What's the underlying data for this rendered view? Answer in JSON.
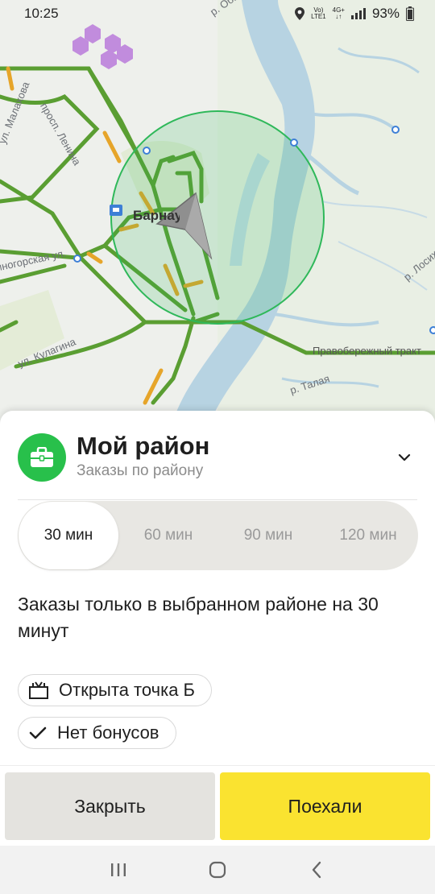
{
  "status_bar": {
    "time": "10:25",
    "network_top": "Vo)",
    "network_bottom": "LTE1",
    "network_gen": "4G+",
    "battery": "93%",
    "icons": [
      "location-icon",
      "signal-icon",
      "battery-icon"
    ]
  },
  "map": {
    "labels": {
      "lenina": "просп. Ленина",
      "malakhova": "ул. Малахова",
      "zmeinogorsk": "Змеиногорская ул.",
      "kulagina": "ул. Кулагина",
      "city": "Барнаул",
      "pravoberezhny": "Правобережный тракт",
      "talaya": "р. Талая",
      "losikha": "р. Лосиха",
      "ob": "р. Обь"
    },
    "colors": {
      "road_green": "#5a9e32",
      "road_orange": "#e6a52a",
      "river": "#b7d3e2",
      "radius": "#2fb85a"
    }
  },
  "sheet": {
    "title": "Мой район",
    "subtitle": "Заказы по району",
    "icon": "briefcase-icon",
    "segments": [
      {
        "label": "30 мин",
        "active": true
      },
      {
        "label": "60 мин",
        "active": false
      },
      {
        "label": "90 мин",
        "active": false
      },
      {
        "label": "120 мин",
        "active": false
      }
    ],
    "description": "Заказы только в выбранном районе на 30 минут",
    "chips": [
      {
        "label": "Открыта точка Б",
        "icon": "gift-icon"
      },
      {
        "label": "Нет бонусов",
        "icon": "check-icon"
      }
    ],
    "buttons": {
      "close": "Закрыть",
      "go": "Поехали"
    },
    "colors": {
      "accent_green": "#28c04b",
      "go_yellow": "#fae330"
    }
  },
  "navbar": {
    "icons": [
      "recent-apps-icon",
      "home-icon",
      "back-icon"
    ]
  }
}
